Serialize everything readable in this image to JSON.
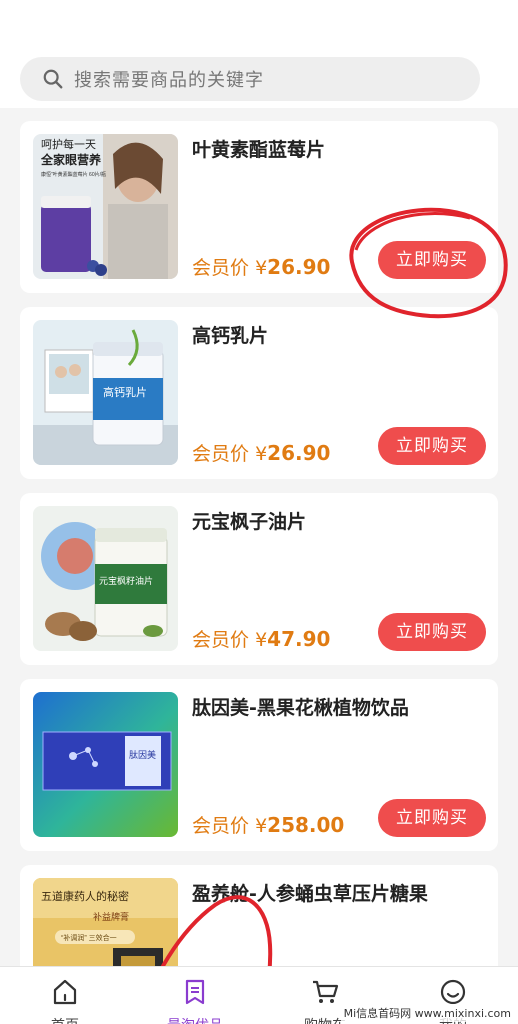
{
  "search": {
    "placeholder": "搜索需要商品的关键字",
    "icon": "search-icon"
  },
  "products": [
    {
      "title": "叶黄素酯蓝莓片",
      "price_label": "会员价",
      "currency": "¥",
      "price": "26.90",
      "buy_label": "立即购买",
      "image_text": {
        "line1": "呵护每一天",
        "line2": "全家眼营养",
        "line3": "康恒”叶黄素酯蓝莓片 60片/瓶"
      }
    },
    {
      "title": "高钙乳片",
      "price_label": "会员价",
      "currency": "¥",
      "price": "26.90",
      "buy_label": "立即购买",
      "image_text": {
        "label": "高钙乳片"
      }
    },
    {
      "title": "元宝枫子油片",
      "price_label": "会员价",
      "currency": "¥",
      "price": "47.90",
      "buy_label": "立即购买",
      "image_text": {
        "label": "元宝枫籽油片"
      }
    },
    {
      "title": "肽因美-黑果花楸植物饮品",
      "price_label": "会员价",
      "currency": "¥",
      "price": "258.00",
      "buy_label": "立即购买",
      "image_text": {
        "label": "肽因美"
      }
    },
    {
      "title": "盈养舱-人参蛹虫草压片糖果",
      "price_label": "",
      "currency": "",
      "price": "",
      "buy_label": "",
      "image_text": {
        "line1": "五道康药人的秘密",
        "line2": "补益牌膏",
        "line3": "“补调润” 三效合一"
      }
    }
  ],
  "tabbar": {
    "items": [
      {
        "label": "首页",
        "icon": "home-icon"
      },
      {
        "label": "最淘优品",
        "icon": "bookmark-list-icon",
        "active": true
      },
      {
        "label": "购物车",
        "icon": "cart-icon"
      },
      {
        "label": "我的",
        "icon": "smiley-icon"
      }
    ]
  },
  "watermark": "Mi信息首码网 www.mixinxi.com",
  "colors": {
    "accent": "#ef4d4d",
    "price": "#e07b12",
    "active_tab": "#8a3ccf",
    "annotation": "#e0242c"
  }
}
